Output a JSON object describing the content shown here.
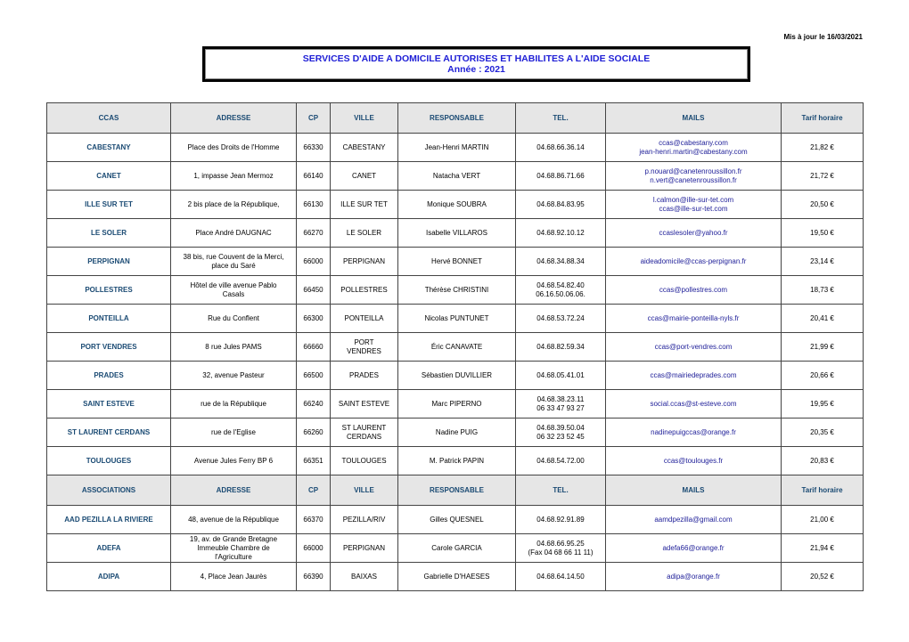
{
  "updated": "Mis à jour le 16/03/2021",
  "title": {
    "line1": "SERVICES  D'AIDE A DOMICILE AUTORISES ET HABILITES A L'AIDE SOCIALE",
    "line2": "Année : 2021"
  },
  "sections": [
    {
      "header": [
        "CCAS",
        "ADRESSE",
        "CP",
        "VILLE",
        "RESPONSABLE",
        "TEL.",
        "MAILS",
        "Tarif horaire"
      ],
      "rows": [
        {
          "name": "CABESTANY",
          "adresse": "Place des Droits de l'Homme",
          "cp": "66330",
          "ville": "CABESTANY",
          "responsable": "Jean-Henri MARTIN",
          "tel": "04.68.66.36.14",
          "mails": "ccas@cabestany.com\njean-henri.martin@cabestany.com",
          "tarif": "21,82 €"
        },
        {
          "name": "CANET",
          "adresse": "1, impasse Jean Mermoz",
          "cp": "66140",
          "ville": "CANET",
          "responsable": "Natacha VERT",
          "tel": "04.68.86.71.66",
          "mails": "p.nouard@canetenroussillon.fr\nn.vert@canetenroussillon.fr",
          "tarif": "21,72 €"
        },
        {
          "name": "ILLE SUR TET",
          "adresse": "2 bis place de la République,",
          "cp": "66130",
          "ville": "ILLE SUR TET",
          "responsable": "Monique SOUBRA",
          "tel": "04.68.84.83.95",
          "mails": "l.calmon@ille-sur-tet.com\nccas@ille-sur-tet.com",
          "tarif": "20,50 €"
        },
        {
          "name": "LE SOLER",
          "adresse": "Place  André DAUGNAC",
          "cp": "66270",
          "ville": "LE SOLER",
          "responsable": "Isabelle VILLAROS",
          "tel": "04.68.92.10.12",
          "mails": "ccaslesoler@yahoo.fr",
          "tarif": "19,50 €"
        },
        {
          "name": "PERPIGNAN",
          "adresse": "38 bis, rue Couvent de la Merci,\nplace du Saré",
          "cp": "66000",
          "ville": "PERPIGNAN",
          "responsable": "Hervé BONNET",
          "tel": "04.68.34.88.34",
          "mails": "aideadomicile@ccas-perpignan.fr",
          "tarif": "23,14 €"
        },
        {
          "name": "POLLESTRES",
          "adresse": "Hôtel de ville avenue Pablo\nCasals",
          "cp": "66450",
          "ville": "POLLESTRES",
          "responsable": "Thérèse CHRISTINI",
          "tel": "04.68.54.82.40\n06.16.50.06.06.",
          "mails": "ccas@pollestres.com",
          "tarif": "18,73 €"
        },
        {
          "name": "PONTEILLA",
          "adresse": "Rue du Conflent",
          "cp": "66300",
          "ville": "PONTEILLA",
          "responsable": "Nicolas PUNTUNET",
          "tel": "04.68.53.72.24",
          "mails": "ccas@mairie-ponteilla-nyls.fr",
          "tarif": "20,41 €"
        },
        {
          "name": "PORT VENDRES",
          "adresse": "8 rue Jules PAMS",
          "cp": "66660",
          "ville": "PORT\nVENDRES",
          "responsable": "Éric CANAVATE",
          "tel": "04.68.82.59.34",
          "mails": "ccas@port-vendres.com",
          "tarif": "21,99 €"
        },
        {
          "name": "PRADES",
          "adresse": "32, avenue Pasteur",
          "cp": "66500",
          "ville": "PRADES",
          "responsable": "Sébastien DUVILLIER",
          "tel": "04.68.05.41.01",
          "mails": "ccas@mairiedeprades.com",
          "tarif": "20,66 €"
        },
        {
          "name": "SAINT ESTEVE",
          "adresse": "rue de la République",
          "cp": "66240",
          "ville": "SAINT ESTEVE",
          "responsable": "Marc PIPERNO",
          "tel": "04.68.38.23.11\n06 33 47 93 27",
          "mails": "social.ccas@st-esteve.com",
          "tarif": "19,95 €"
        },
        {
          "name": "ST LAURENT CERDANS",
          "adresse": "rue de l'Eglise",
          "cp": "66260",
          "ville": "ST LAURENT\nCERDANS",
          "responsable": "Nadine PUIG",
          "tel": "04.68.39.50.04\n06 32 23 52 45",
          "mails": "nadinepuigccas@orange.fr",
          "tarif": "20,35 €"
        },
        {
          "name": "TOULOUGES",
          "adresse": "Avenue Jules Ferry  BP 6",
          "cp": "66351",
          "ville": "TOULOUGES",
          "responsable": "M. Patrick PAPIN",
          "tel": "04.68.54.72.00",
          "mails": "ccas@toulouges.fr",
          "tarif": "20,83 €"
        }
      ]
    },
    {
      "header": [
        "ASSOCIATIONS",
        "ADRESSE",
        "CP",
        "VILLE",
        "RESPONSABLE",
        "TEL.",
        "MAILS",
        "Tarif horaire"
      ],
      "rows": [
        {
          "name": "AAD PEZILLA LA RIVIERE",
          "adresse": "48, avenue de la République",
          "cp": "66370",
          "ville": "PEZILLA/RIV",
          "responsable": "Gilles QUESNEL",
          "tel": "04.68.92.91.89",
          "mails": "aamdpezilla@gmail.com",
          "tarif": "21,00 €"
        },
        {
          "name": "ADEFA",
          "adresse": "19, av. de Grande Bretagne\nImmeuble Chambre de\nl'Agriculture",
          "cp": "66000",
          "ville": "PERPIGNAN",
          "responsable": "Carole GARCIA",
          "tel": "04.68.66.95.25\n(Fax 04 68 66 11 11)",
          "mails": "adefa66@orange.fr",
          "tarif": "21,94 €"
        },
        {
          "name": "ADIPA",
          "adresse": "4, Place Jean Jaurès",
          "cp": "66390",
          "ville": "BAIXAS",
          "responsable": "Gabrielle D'HAESES",
          "tel": "04.68.64.14.50",
          "mails": "adipa@orange.fr",
          "tarif": "20,52 €"
        }
      ]
    }
  ]
}
